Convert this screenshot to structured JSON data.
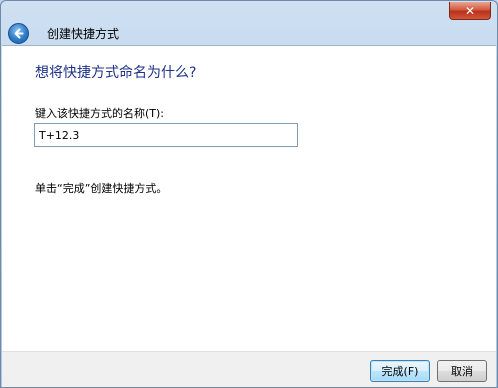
{
  "window": {
    "title": "创建快捷方式",
    "close_glyph": "✕",
    "back_icon": "back-arrow-icon",
    "accent_color": "#1e3287"
  },
  "page": {
    "heading": "想将快捷方式命名为什么?",
    "field_label": "键入该快捷方式的名称(T):",
    "name_value": "T+12.3",
    "hint": "单击“完成”创建快捷方式。"
  },
  "buttons": {
    "finish": "完成(F)",
    "cancel": "取消"
  }
}
